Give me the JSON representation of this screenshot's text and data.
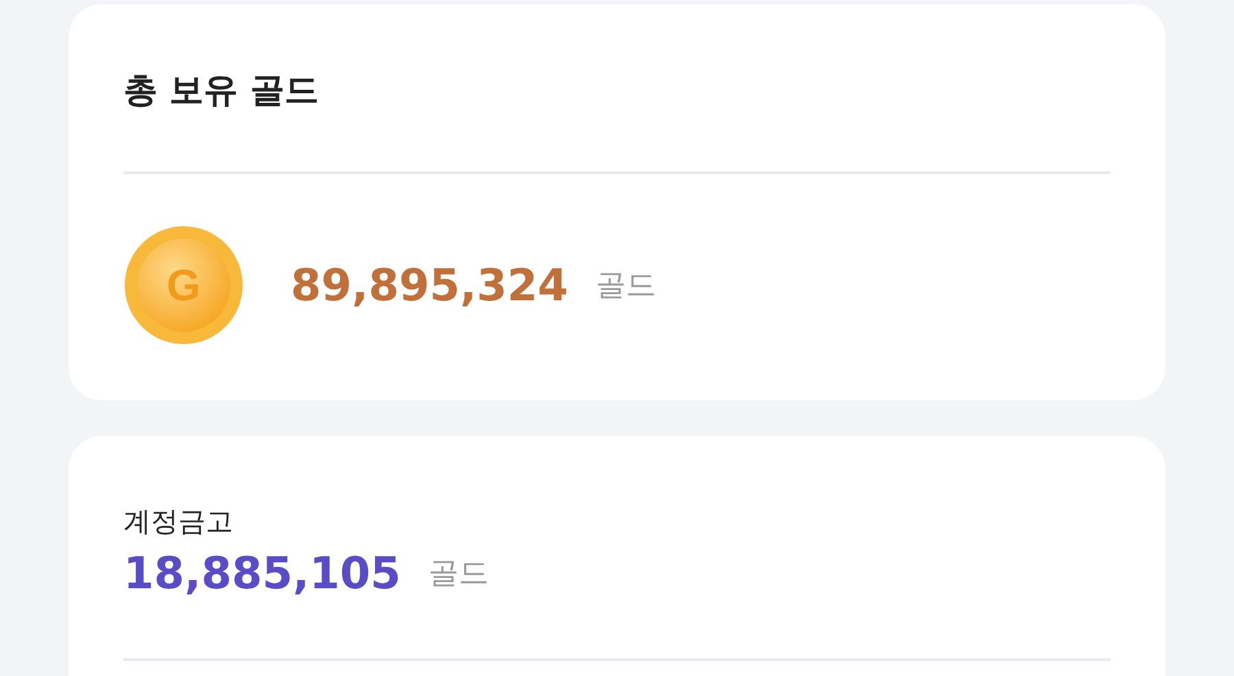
{
  "total_gold": {
    "title": "총 보유 골드",
    "coin_letter": "G",
    "amount": "89,895,324",
    "unit": "골드"
  },
  "account_vault": {
    "label": "계정금고",
    "amount": "18,885,105",
    "unit": "골드"
  }
}
